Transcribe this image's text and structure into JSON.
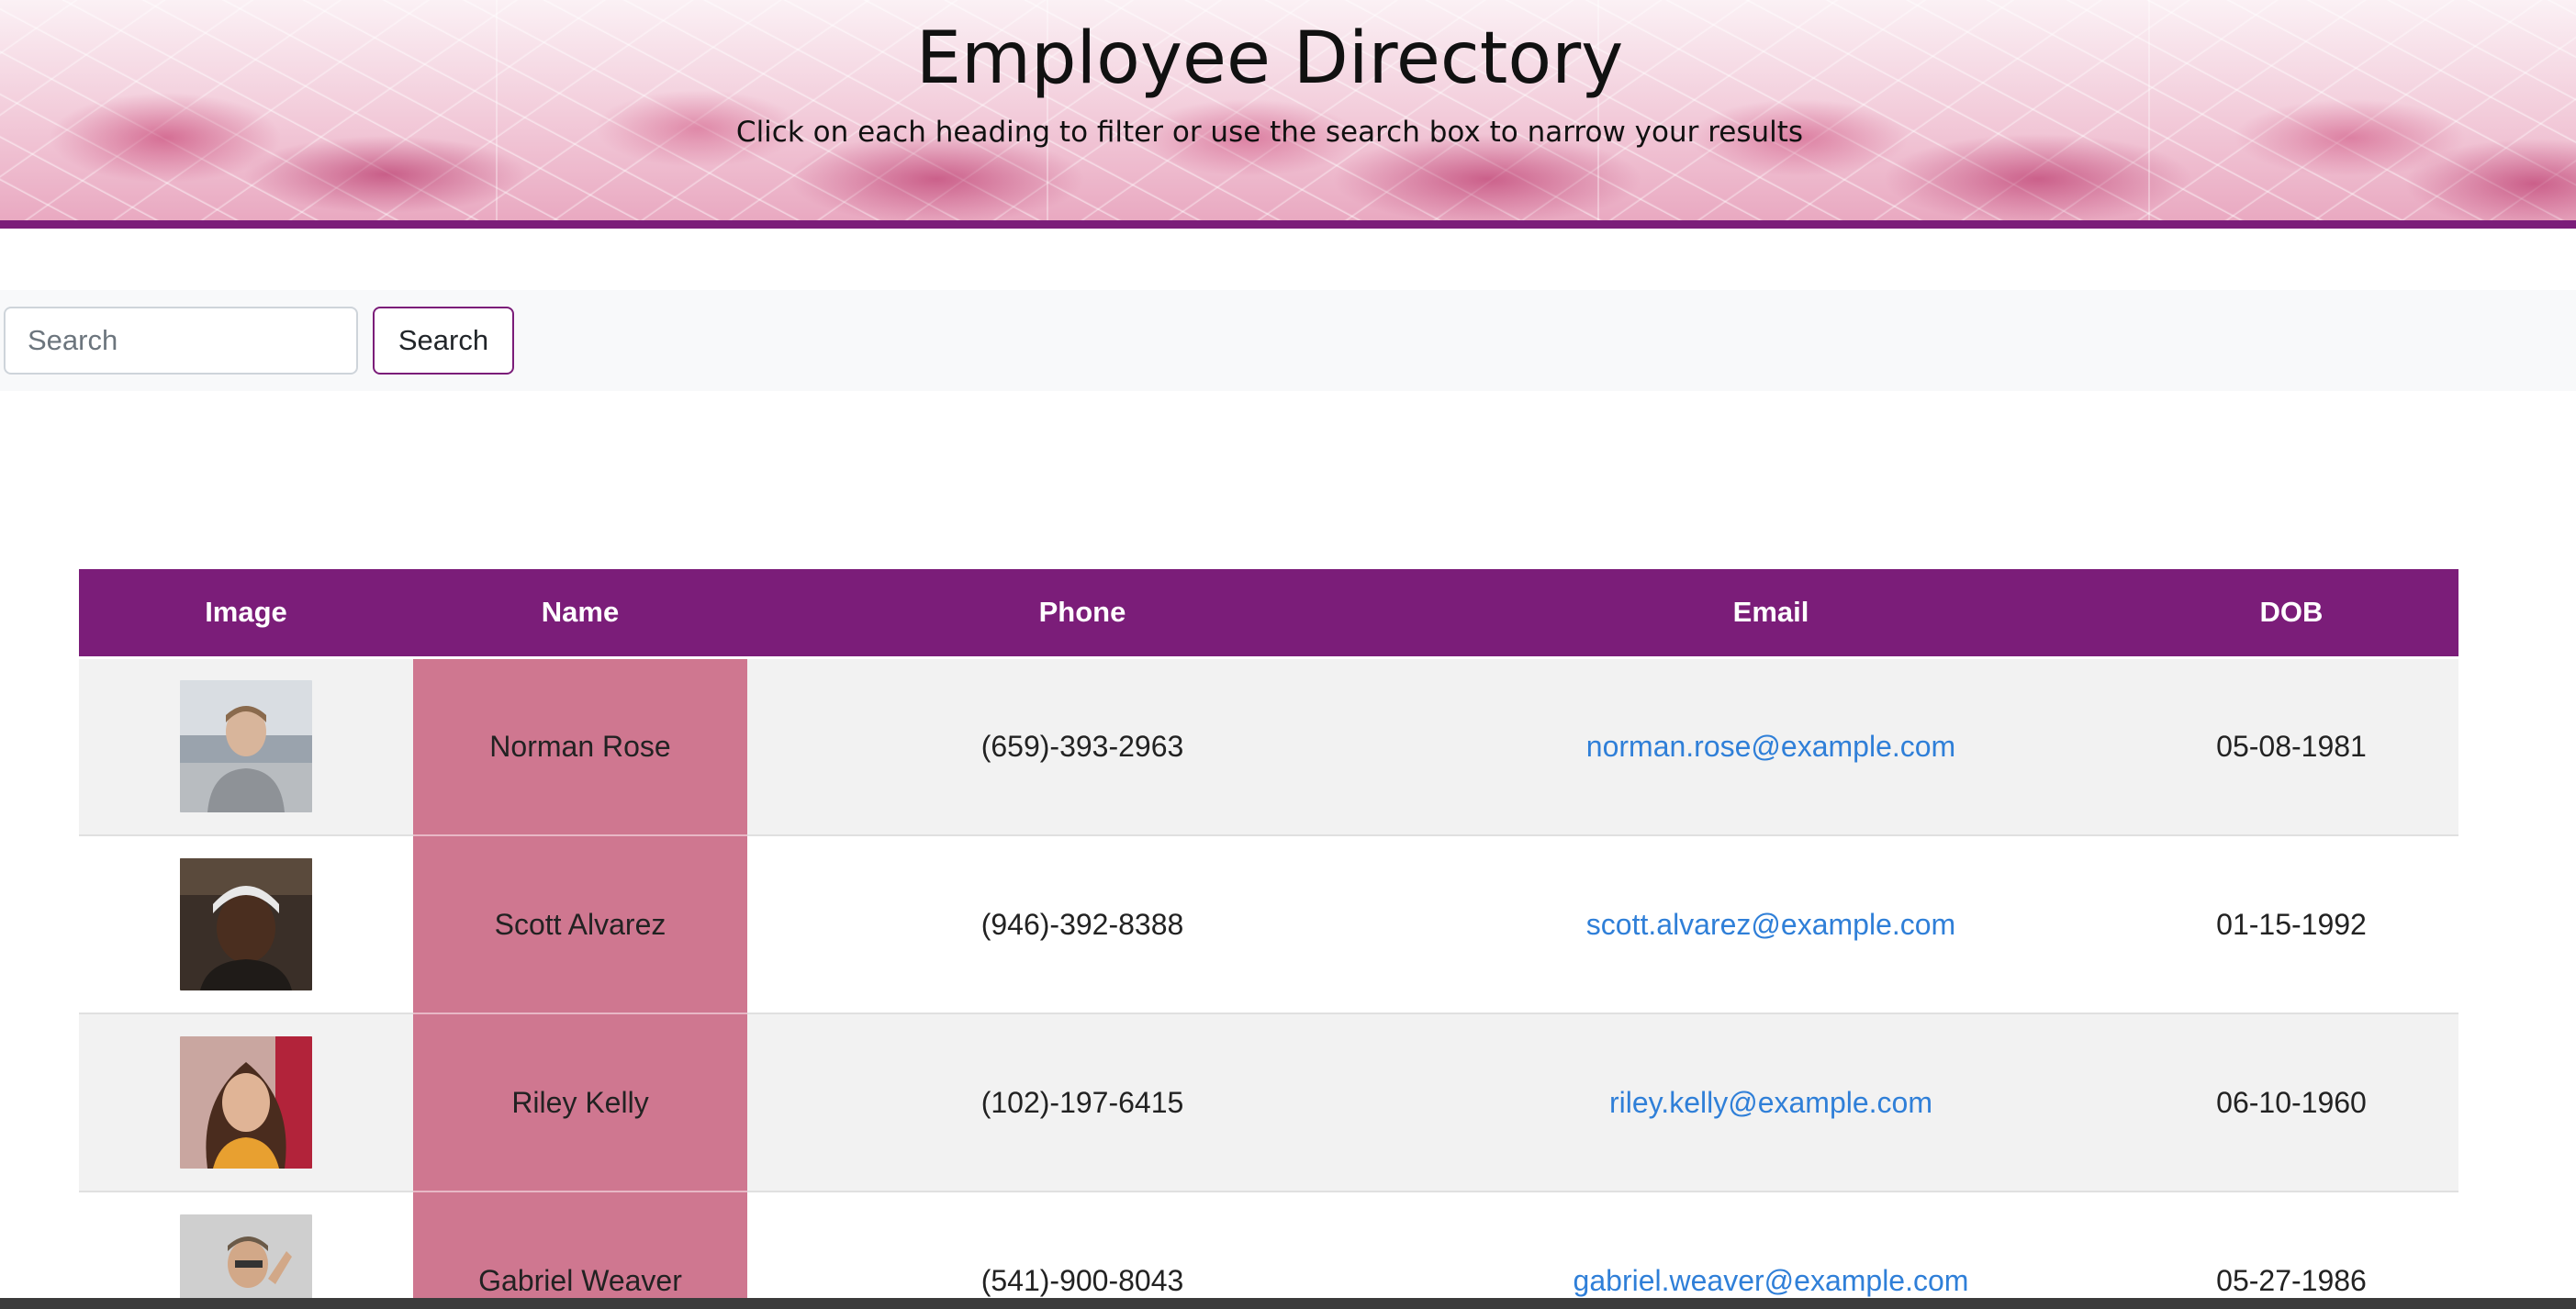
{
  "header": {
    "title": "Employee Directory",
    "subtitle": "Click on each heading to filter or use the search box to narrow your results"
  },
  "search": {
    "placeholder": "Search",
    "value": "",
    "button_label": "Search"
  },
  "table": {
    "columns": [
      "Image",
      "Name",
      "Phone",
      "Email",
      "DOB"
    ],
    "rows": [
      {
        "image": "portrait-photo",
        "name": "Norman Rose",
        "phone": "(659)-393-2963",
        "email": "norman.rose@example.com",
        "dob": "05-08-1981"
      },
      {
        "image": "portrait-photo",
        "name": "Scott Alvarez",
        "phone": "(946)-392-8388",
        "email": "scott.alvarez@example.com",
        "dob": "01-15-1992"
      },
      {
        "image": "portrait-photo",
        "name": "Riley Kelly",
        "phone": "(102)-197-6415",
        "email": "riley.kelly@example.com",
        "dob": "06-10-1960"
      },
      {
        "image": "portrait-photo",
        "name": "Gabriel Weaver",
        "phone": "(541)-900-8043",
        "email": "gabriel.weaver@example.com",
        "dob": "05-27-1986"
      }
    ]
  },
  "colors": {
    "accent_purple": "#7b1d79",
    "name_column_pink": "#cf7790",
    "link_blue": "#2f7fd8"
  }
}
